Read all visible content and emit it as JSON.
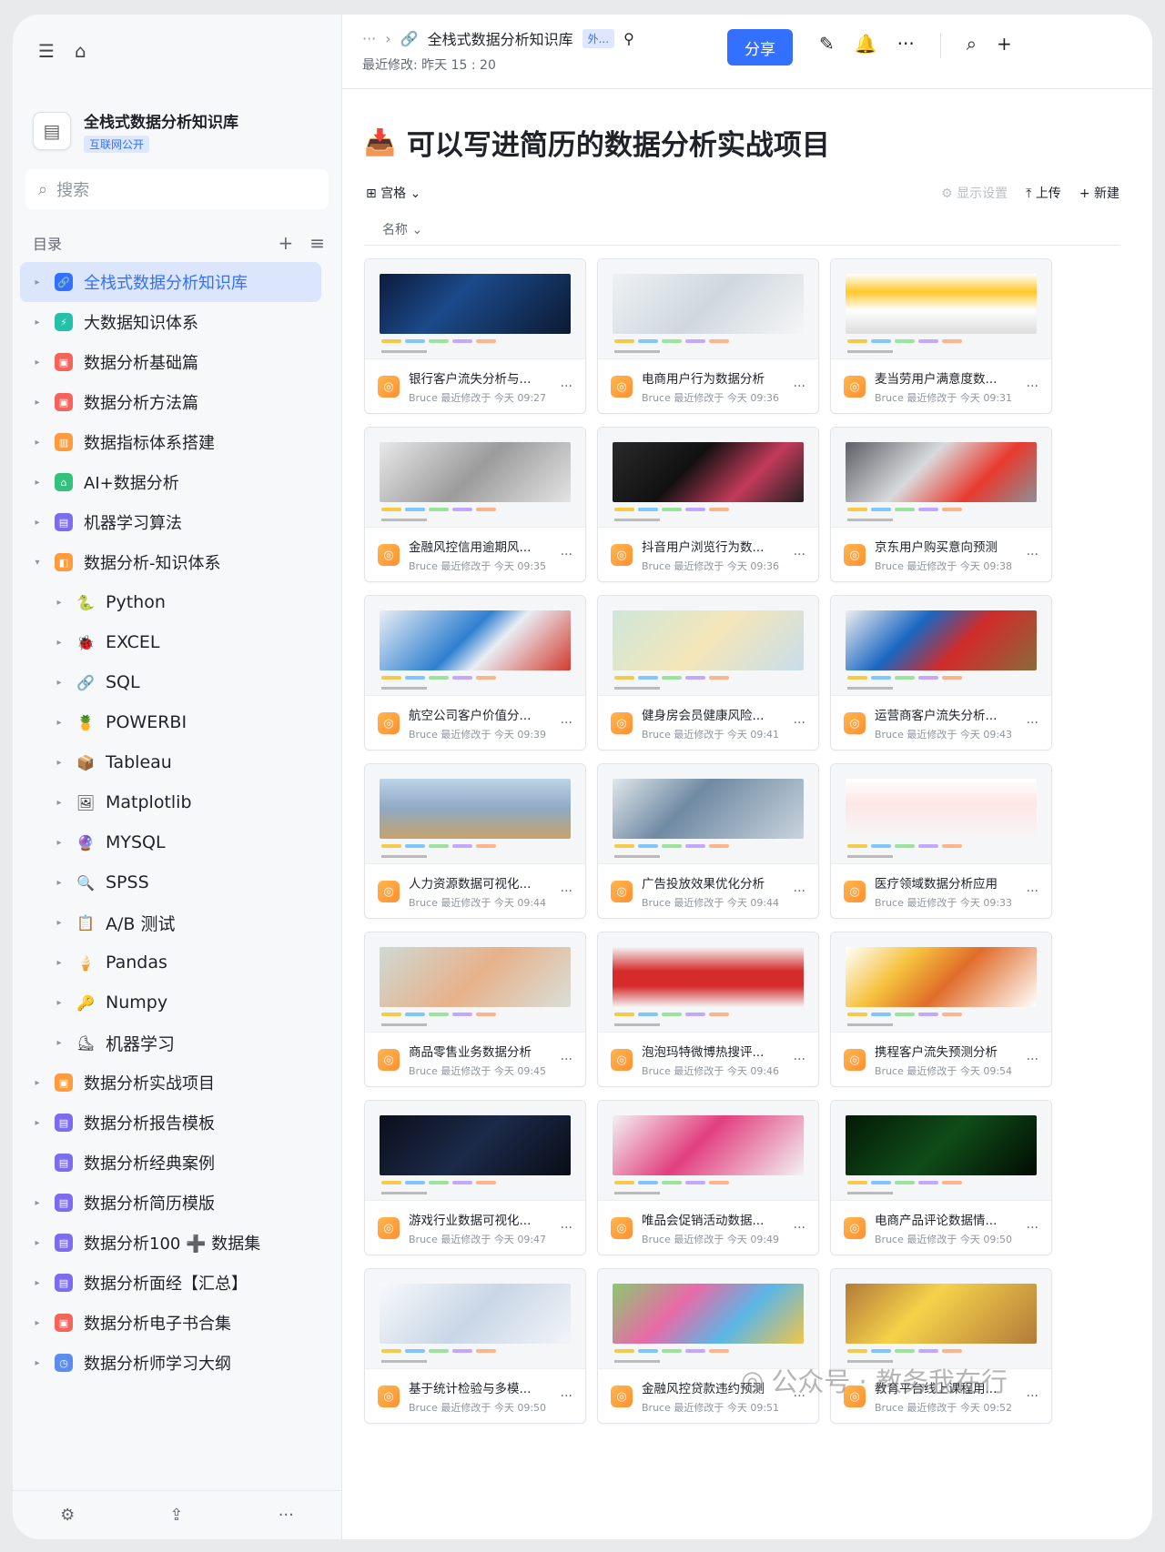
{
  "sidebar": {
    "kb_title": "全栈式数据分析知识库",
    "kb_badge": "互联网公开",
    "search_placeholder": "搜索",
    "toc_label": "目录",
    "items": [
      {
        "label": "全栈式数据分析知识库",
        "level": 0,
        "caret": "▸",
        "color": "#3370ff",
        "glyph": "🔗",
        "active": true
      },
      {
        "label": "大数据知识体系",
        "level": 0,
        "caret": "▸",
        "color": "#23c1a7",
        "glyph": "⚡"
      },
      {
        "label": "数据分析基础篇",
        "level": 0,
        "caret": "▸",
        "color": "#f5635b",
        "glyph": "▣"
      },
      {
        "label": "数据分析方法篇",
        "level": 0,
        "caret": "▸",
        "color": "#f5635b",
        "glyph": "▣"
      },
      {
        "label": "数据指标体系搭建",
        "level": 0,
        "caret": "▸",
        "color": "#ff9b3d",
        "glyph": "▥"
      },
      {
        "label": "AI+数据分析",
        "level": 0,
        "caret": "▸",
        "color": "#33c27d",
        "glyph": "⌂"
      },
      {
        "label": "机器学习算法",
        "level": 0,
        "caret": "▸",
        "color": "#7b6cf0",
        "glyph": "▤"
      },
      {
        "label": "数据分析-知识体系",
        "level": 0,
        "caret": "▾",
        "color": "#ff9b3d",
        "glyph": "◧"
      },
      {
        "label": "Python",
        "level": 1,
        "caret": "▸",
        "glyph": "🐍"
      },
      {
        "label": "EXCEL",
        "level": 1,
        "caret": "▸",
        "glyph": "🐞"
      },
      {
        "label": "SQL",
        "level": 1,
        "caret": "▸",
        "glyph": "🔗"
      },
      {
        "label": "POWERBI",
        "level": 1,
        "caret": "▸",
        "glyph": "🍍"
      },
      {
        "label": "Tableau",
        "level": 1,
        "caret": "▸",
        "glyph": "📦"
      },
      {
        "label": "Matplotlib",
        "level": 1,
        "caret": "▸",
        "glyph": "🖼"
      },
      {
        "label": "MYSQL",
        "level": 1,
        "caret": "▸",
        "glyph": "🔮"
      },
      {
        "label": "SPSS",
        "level": 1,
        "caret": "▸",
        "glyph": "🔍"
      },
      {
        "label": "A/B 测试",
        "level": 1,
        "caret": "▸",
        "glyph": "📋"
      },
      {
        "label": "Pandas",
        "level": 1,
        "caret": "▸",
        "glyph": "🍦"
      },
      {
        "label": "Numpy",
        "level": 1,
        "caret": "▸",
        "glyph": "🔑"
      },
      {
        "label": "机器学习",
        "level": 1,
        "caret": "▸",
        "glyph": "⛸"
      },
      {
        "label": "数据分析实战项目",
        "level": 0,
        "caret": "▸",
        "color": "#ff9b3d",
        "glyph": "▣"
      },
      {
        "label": "数据分析报告模板",
        "level": 0,
        "caret": "▸",
        "color": "#7b6cf0",
        "glyph": "▤"
      },
      {
        "label": "数据分析经典案例",
        "level": 0,
        "caret": "",
        "color": "#7b6cf0",
        "glyph": "▤"
      },
      {
        "label": "数据分析简历模版",
        "level": 0,
        "caret": "▸",
        "color": "#7b6cf0",
        "glyph": "▤"
      },
      {
        "label": "数据分析100 ➕ 数据集",
        "level": 0,
        "caret": "▸",
        "color": "#7b6cf0",
        "glyph": "▤"
      },
      {
        "label": "数据分析面经【汇总】",
        "level": 0,
        "caret": "▸",
        "color": "#7b6cf0",
        "glyph": "▤"
      },
      {
        "label": "数据分析电子书合集",
        "level": 0,
        "caret": "▸",
        "color": "#f5635b",
        "glyph": "▣"
      },
      {
        "label": "数据分析师学习大纲",
        "level": 0,
        "caret": "▸",
        "color": "#5b8def",
        "glyph": "◷"
      }
    ]
  },
  "header": {
    "breadcrumb_dots": "···",
    "kb_title": "全栈式数据分析知识库",
    "ext_badge": "外...",
    "modified": "最近修改: 昨天 15 : 20",
    "share_label": "分享"
  },
  "page": {
    "title": "可以写进简历的数据分析实战项目",
    "view_label": "宫格 ⌄",
    "display_settings": "显示设置",
    "upload": "上传",
    "new": "新建",
    "sort_label": "名称 ⌄"
  },
  "cards": [
    {
      "title": "银行客户流失分析与...",
      "sub": "Bruce 最近修改于 今天 09:27",
      "bg": "linear-gradient(135deg,#0d1b3d,#1c4a8a 40%,#0b1a33)"
    },
    {
      "title": "电商用户行为数据分析",
      "sub": "Bruce 最近修改于 今天 09:36",
      "bg": "linear-gradient(135deg,#eef1f4,#cfd8de 50%,#f5f5f5)"
    },
    {
      "title": "麦当劳用户满意度数...",
      "sub": "Bruce 最近修改于 今天 09:31",
      "bg": "linear-gradient(180deg,#fff 0%,#ffc72c 30%,#fff 60%,#ddd)"
    },
    {
      "title": "金融风控信用逾期风...",
      "sub": "Bruce 最近修改于 今天 09:35",
      "bg": "linear-gradient(135deg,#e8e8e8,#9b9b9b 50%,#e3e3e3)"
    },
    {
      "title": "抖音用户浏览行为数...",
      "sub": "Bruce 最近修改于 今天 09:36",
      "bg": "linear-gradient(135deg,#2a2a2a,#111 40%,#c23b5a 70%,#222)"
    },
    {
      "title": "京东用户购买意向预测",
      "sub": "Bruce 最近修改于 今天 09:38",
      "bg": "linear-gradient(135deg,#5c5f66,#d9dadd 40%,#e83a2e 70%,#8c8f94)"
    },
    {
      "title": "航空公司客户价值分...",
      "sub": "Bruce 最近修改于 今天 09:39",
      "bg": "linear-gradient(135deg,#e8eef5,#2f7fd0 45%,#e8eef5 60%,#d13b2f)"
    },
    {
      "title": "健身房会员健康风险...",
      "sub": "Bruce 最近修改于 今天 09:41",
      "bg": "linear-gradient(135deg,#cfe6d9,#f4e6b9 50%,#c8ddeb)"
    },
    {
      "title": "运营商客户流失分析...",
      "sub": "Bruce 最近修改于 今天 09:43",
      "bg": "linear-gradient(135deg,#eee,#1a66c2 35%,#d12b2b 60%,#8a6b3a)"
    },
    {
      "title": "人力资源数据可视化...",
      "sub": "Bruce 最近修改于 今天 09:44",
      "bg": "linear-gradient(180deg,#bcd3e8,#8fa9c4 50%,#c7a36b)"
    },
    {
      "title": "广告投放效果优化分析",
      "sub": "Bruce 最近修改于 今天 09:44",
      "bg": "linear-gradient(135deg,#e0e6ec,#6f8aa3 40%,#c9d4dd)"
    },
    {
      "title": "医疗领域数据分析应用",
      "sub": "Bruce 最近修改于 今天 09:33",
      "bg": "linear-gradient(180deg,#fff,#fde6e6 40%,#f6f6f6)"
    },
    {
      "title": "商品零售业务数据分析",
      "sub": "Bruce 最近修改于 今天 09:45",
      "bg": "linear-gradient(135deg,#cfd9d4,#e7b18a 50%,#d9ded8)"
    },
    {
      "title": "泡泡玛特微博热搜评...",
      "sub": "Bruce 最近修改于 今天 09:46",
      "bg": "linear-gradient(180deg,#f4f4f4,#d62b2b 40%,#d62b2b 65%,#f4f4f4)"
    },
    {
      "title": "携程客户流失预测分析",
      "sub": "Bruce 最近修改于 今天 09:54",
      "bg": "linear-gradient(135deg,#fff,#f6c23e 30%,#e06c2a 55%,#fff)"
    },
    {
      "title": "游戏行业数据可视化...",
      "sub": "Bruce 最近修改于 今天 09:47",
      "bg": "linear-gradient(135deg,#0c0f1a,#1b2a4a 50%,#0a0d16)"
    },
    {
      "title": "唯品会促销活动数据...",
      "sub": "Bruce 最近修改于 今天 09:49",
      "bg": "linear-gradient(135deg,#f2f2f2,#e23f7e 45%,#f2f2f2)"
    },
    {
      "title": "电商产品评论数据情...",
      "sub": "Bruce 最近修改于 今天 09:50",
      "bg": "linear-gradient(135deg,#041a06,#0f4d18 50%,#020c03)"
    },
    {
      "title": "基于统计检验与多模...",
      "sub": "Bruce 最近修改于 今天 09:50",
      "bg": "linear-gradient(135deg,#f7f9fb,#c8d6e6 50%,#f2f4f7)"
    },
    {
      "title": "金融风控贷款违约预测",
      "sub": "Bruce 最近修改于 今天 09:51",
      "bg": "linear-gradient(135deg,#8ac96e,#e86aa8 35%,#5ab7e6 65%,#f1c54a)"
    },
    {
      "title": "教育平台线上课程用...",
      "sub": "Bruce 最近修改于 今天 09:52",
      "bg": "linear-gradient(135deg,#b37a3a,#f5d24a 40%,#b37a3a)"
    }
  ],
  "watermark": "公众号 · 教务我在行"
}
